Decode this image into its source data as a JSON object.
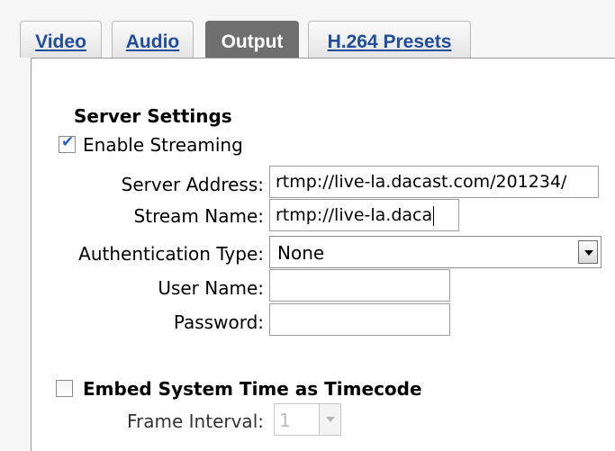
{
  "tabs": [
    {
      "label": "Video",
      "active": false
    },
    {
      "label": "Audio",
      "active": false
    },
    {
      "label": "Output",
      "active": true
    },
    {
      "label": "H.264 Presets",
      "active": false
    }
  ],
  "server_settings": {
    "title": "Server Settings",
    "enable_streaming": {
      "label": "Enable Streaming",
      "checked": true
    },
    "server_address": {
      "label": "Server Address:",
      "value": "rtmp://live-la.dacast.com/201234/"
    },
    "stream_name": {
      "label": "Stream Name:",
      "value": "rtmp://live-la.daca"
    },
    "authentication_type": {
      "label": "Authentication Type:",
      "value": "None"
    },
    "user_name": {
      "label": "User Name:",
      "value": ""
    },
    "password": {
      "label": "Password:",
      "value": ""
    }
  },
  "timecode": {
    "embed": {
      "label": "Embed System Time as Timecode",
      "checked": false
    },
    "frame_interval": {
      "label": "Frame Interval:",
      "value": "1",
      "enabled": false
    }
  },
  "colors": {
    "link": "#1f4e9e",
    "active_tab": "#6f6f6f",
    "check": "#2a62c9"
  }
}
